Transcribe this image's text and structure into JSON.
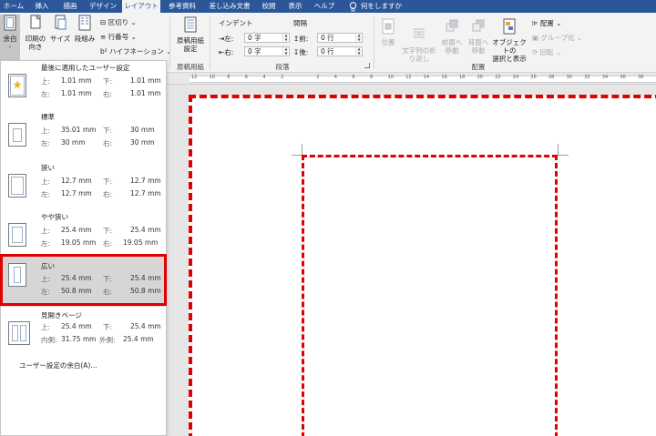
{
  "tabs": [
    "ホーム",
    "挿入",
    "描画",
    "デザイン",
    "レイアウト",
    "参考資料",
    "差し込み文書",
    "校閲",
    "表示",
    "ヘルプ"
  ],
  "active_tab": "レイアウト",
  "tell_me": "何をしますか",
  "ribbon": {
    "margins_label": "余白",
    "orientation_label": "印刷の\n向き",
    "size_label": "サイズ",
    "columns_label": "段組み",
    "breaks_label": "区切り",
    "line_numbers_label": "行番号",
    "hyphenation_label": "ハイフネーション",
    "manuscript_label": "原稿用紙\n設定",
    "manuscript_group": "原稿用紙",
    "indent_header": "インデント",
    "spacing_header": "間隔",
    "indent_left_label": "左:",
    "indent_left_value": "0 字",
    "indent_right_label": "右:",
    "indent_right_value": "0 字",
    "spacing_before_label": "前:",
    "spacing_before_value": "0 行",
    "spacing_after_label": "後:",
    "spacing_after_value": "0 行",
    "paragraph_group": "段落",
    "position_label": "位置",
    "wrap_label": "文字列の折\nり返し",
    "forward_label": "前面へ\n移動",
    "backward_label": "背面へ\n移動",
    "selection_pane_label": "オブジェクトの\n選択と表示",
    "align_label": "配置",
    "group_label": "グループ化",
    "rotate_label": "回転",
    "arrange_group": "配置"
  },
  "ruler_numbers": [
    "12",
    "10",
    "8",
    "6",
    "4",
    "2",
    "",
    "2",
    "4",
    "6",
    "8",
    "10",
    "12",
    "14",
    "16",
    "18",
    "20",
    "22",
    "24",
    "26",
    "28",
    "30",
    "32",
    "34",
    "36",
    "38"
  ],
  "margins_menu": {
    "presets": [
      {
        "name": "最後に適用したユーザー設定",
        "top_k": "上:",
        "top": "1.01 mm",
        "bottom_k": "下:",
        "bottom": "1.01 mm",
        "left_k": "左:",
        "left": "1.01 mm",
        "right_k": "右:",
        "right": "1.01 mm"
      },
      {
        "name": "標準",
        "top_k": "上:",
        "top": "35.01 mm",
        "bottom_k": "下:",
        "bottom": "30 mm",
        "left_k": "左:",
        "left": "30 mm",
        "right_k": "右:",
        "right": "30 mm"
      },
      {
        "name": "狭い",
        "top_k": "上:",
        "top": "12.7 mm",
        "bottom_k": "下:",
        "bottom": "12.7 mm",
        "left_k": "左:",
        "left": "12.7 mm",
        "right_k": "右:",
        "right": "12.7 mm"
      },
      {
        "name": "やや狭い",
        "top_k": "上:",
        "top": "25.4 mm",
        "bottom_k": "下:",
        "bottom": "25.4 mm",
        "left_k": "左:",
        "left": "19.05 mm",
        "right_k": "右:",
        "right": "19.05 mm"
      },
      {
        "name": "広い",
        "top_k": "上:",
        "top": "25.4 mm",
        "bottom_k": "下:",
        "bottom": "25.4 mm",
        "left_k": "左:",
        "left": "50.8 mm",
        "right_k": "右:",
        "right": "50.8 mm"
      },
      {
        "name": "見開きページ",
        "top_k": "上:",
        "top": "25.4 mm",
        "bottom_k": "下:",
        "bottom": "25.4 mm",
        "left_k": "内側:",
        "left": "31.75 mm",
        "right_k": "外側:",
        "right": "25.4 mm"
      }
    ],
    "custom_label": "ユーザー設定の余白(A)..."
  },
  "colors": {
    "accent": "#2b579a",
    "highlight": "#e00000"
  }
}
